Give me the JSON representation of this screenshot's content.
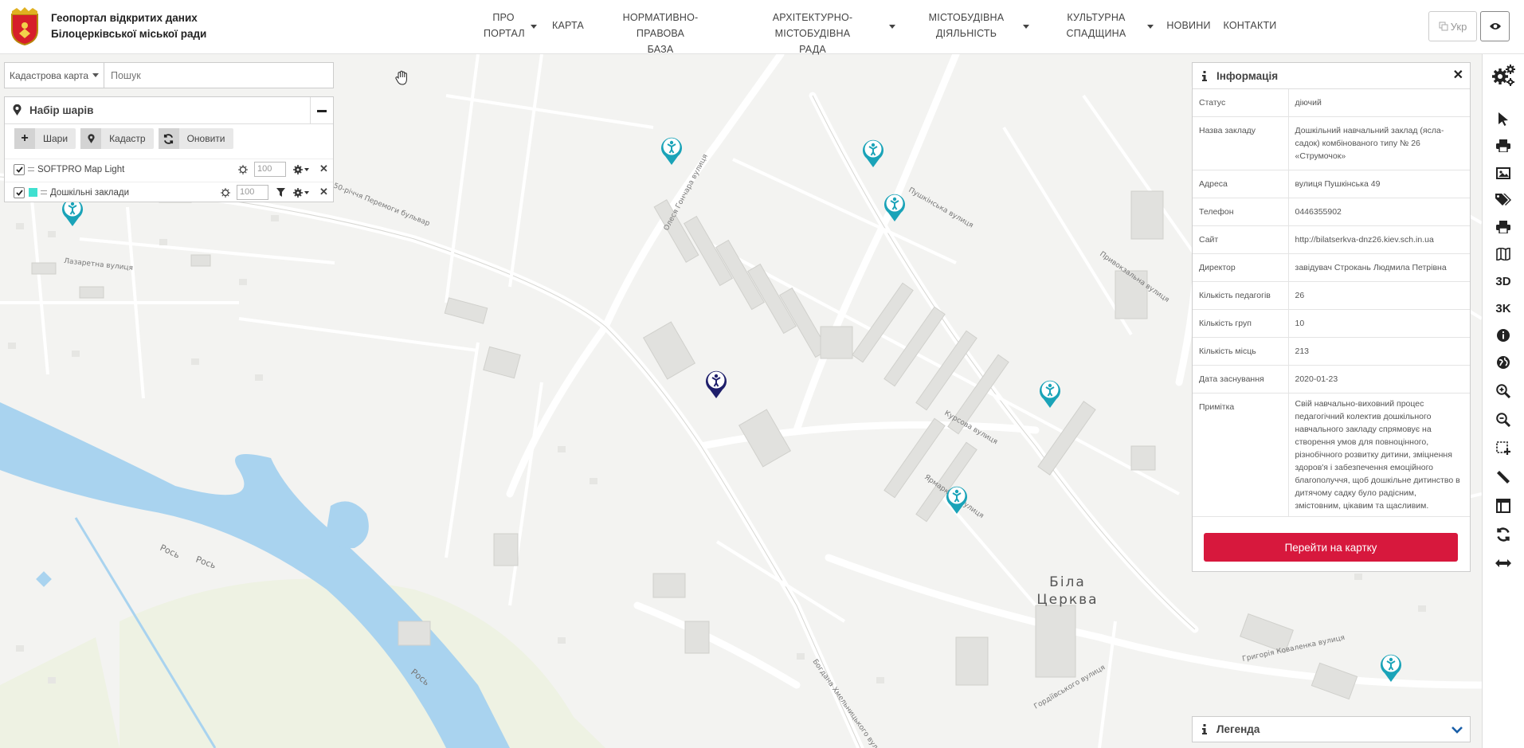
{
  "header": {
    "site_title_line1": "Геопортал відкритих даних",
    "site_title_line2": "Білоцерківської міської ради",
    "nav": [
      {
        "line1": "ПРО",
        "line2": "ПОРТАЛ"
      },
      {
        "line1": "КАРТА",
        "line2": ""
      },
      {
        "line1": "НОРМАТИВНО-ПРАВОВА",
        "line2": "БАЗА"
      },
      {
        "line1": "АРХІТЕКТУРНО-МІСТОБУДІВНА",
        "line2": "РАДА"
      },
      {
        "line1": "МІСТОБУДІВНА",
        "line2": "ДІЯЛЬНІСТЬ"
      },
      {
        "line1": "КУЛЬТУРНА",
        "line2": "СПАДЩИНА"
      },
      {
        "line1": "НОВИНИ",
        "line2": ""
      },
      {
        "line1": "КОНТАКТИ",
        "line2": ""
      }
    ],
    "lang_label": "Укр"
  },
  "search": {
    "selected_map": "Кадастрова карта",
    "placeholder": "Пошук"
  },
  "layers": {
    "title": "Набір шарів",
    "toolbar": {
      "layers": "Шари",
      "cadastre": "Кадастр",
      "refresh": "Оновити"
    },
    "items": [
      {
        "name": "SOFTPRO Map Light",
        "opacity": "100",
        "color": ""
      },
      {
        "name": "Дошкільні заклади",
        "opacity": "100",
        "color": "#40e0d0"
      }
    ]
  },
  "info": {
    "title": "Інформація",
    "rows": [
      {
        "k": "Статус",
        "v": "діючий"
      },
      {
        "k": "Назва закладу",
        "v": "Дошкільний навчальний заклад (ясла-садок) комбінованого типу № 26 «Струмочок»"
      },
      {
        "k": "Адреса",
        "v": "вулиця Пушкінська 49"
      },
      {
        "k": "Телефон",
        "v": "0446355902"
      },
      {
        "k": "Сайт",
        "v": "http://bilatserkva-dnz26.kiev.sch.in.ua"
      },
      {
        "k": "Директор",
        "v": "завідувач Строкань Людмила Петрівна"
      },
      {
        "k": "Кількість педагогів",
        "v": "26"
      },
      {
        "k": "Кількість груп",
        "v": "10"
      },
      {
        "k": "Кількість місць",
        "v": "213"
      },
      {
        "k": "Дата заснування",
        "v": "2020-01-23"
      },
      {
        "k": "Примітка",
        "v": "Свій навчально-виховний процес педагогічний колектив дошкільного навчального закладу спрямовує на створення умов для повноцінного, різнобічного розвитку дитини, зміцнення здоров'я і забезпечення емоційного благополуччя, щоб дошкільне дитинство в дитячому садку було радісним, змістовним, цікавим та щасливим."
      }
    ],
    "button": "Перейти на картку"
  },
  "legend": {
    "title": "Легенда"
  },
  "map": {
    "city_label_line1": "Біла",
    "city_label_line2": "Церква",
    "streets": [
      "50-річчя Перемоги бульвар",
      "Олеся Гончара вулиця",
      "Пушкінська вулиця",
      "Привокзальна вулиця",
      "Рось",
      "Рось",
      "Рось",
      "Лазаретна вулиця",
      "Курсова вулиця",
      "Григорія Коваленка вулиця",
      "Богдана Хмельницького вулиця",
      "Ярмаркова вулиця",
      "Гордіївського вулиця"
    ],
    "marker_color": "#1aa3b8",
    "selected_marker_color": "#1f1f6b"
  },
  "right_toolbar": {
    "label_3d": "3D",
    "label_3k": "3K"
  }
}
